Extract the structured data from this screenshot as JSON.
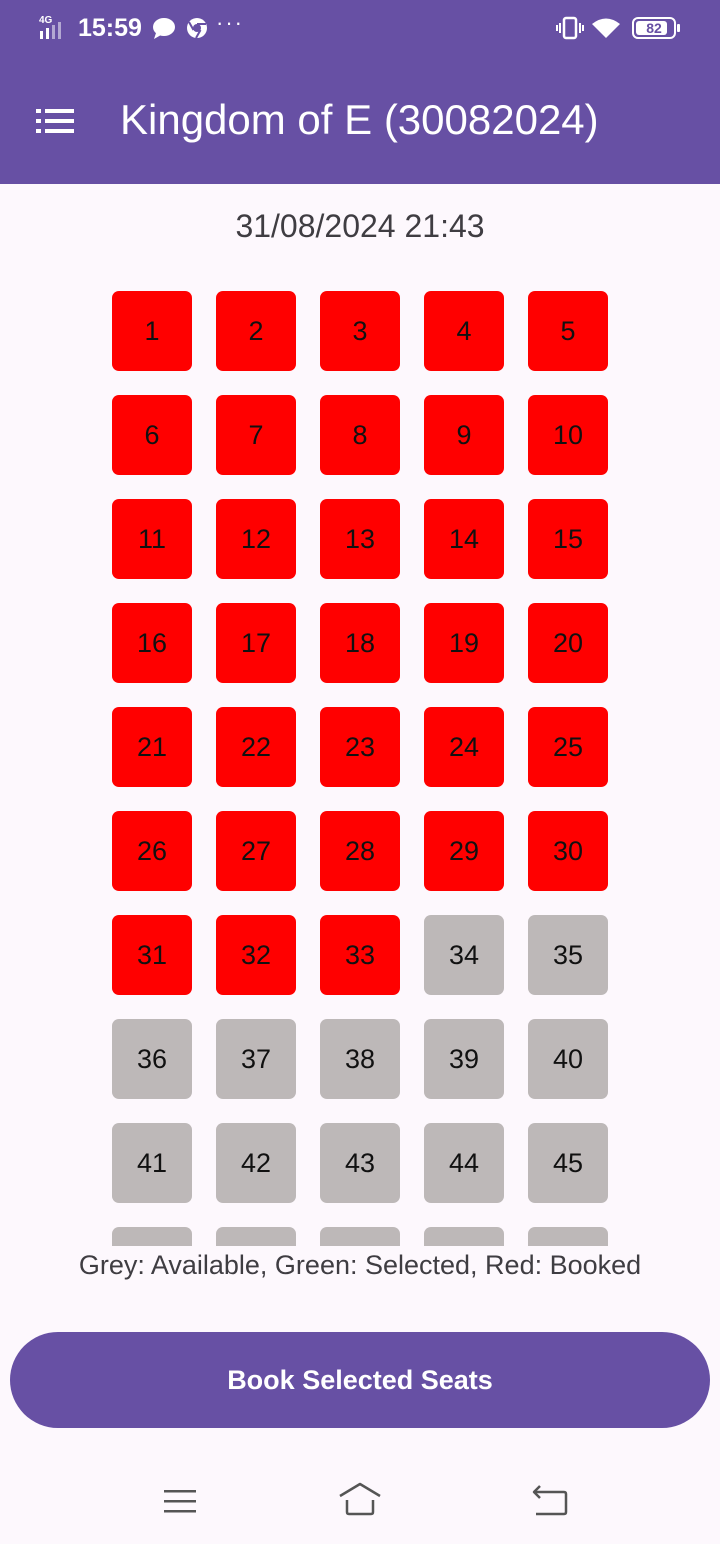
{
  "status_bar": {
    "network": "4G",
    "time": "15:59",
    "battery": "82",
    "icons": [
      "signal-icon",
      "chat-bubble-icon",
      "chrome-icon",
      "more-dots-icon",
      "vibrate-icon",
      "wifi-icon",
      "battery-icon"
    ]
  },
  "app_bar": {
    "title": "Kingdom of E (30082024)",
    "menu_icon": "list-menu-icon"
  },
  "datetime": "31/08/2024 21:43",
  "seats": [
    {
      "number": "1",
      "status": "booked"
    },
    {
      "number": "2",
      "status": "booked"
    },
    {
      "number": "3",
      "status": "booked"
    },
    {
      "number": "4",
      "status": "booked"
    },
    {
      "number": "5",
      "status": "booked"
    },
    {
      "number": "6",
      "status": "booked"
    },
    {
      "number": "7",
      "status": "booked"
    },
    {
      "number": "8",
      "status": "booked"
    },
    {
      "number": "9",
      "status": "booked"
    },
    {
      "number": "10",
      "status": "booked"
    },
    {
      "number": "11",
      "status": "booked"
    },
    {
      "number": "12",
      "status": "booked"
    },
    {
      "number": "13",
      "status": "booked"
    },
    {
      "number": "14",
      "status": "booked"
    },
    {
      "number": "15",
      "status": "booked"
    },
    {
      "number": "16",
      "status": "booked"
    },
    {
      "number": "17",
      "status": "booked"
    },
    {
      "number": "18",
      "status": "booked"
    },
    {
      "number": "19",
      "status": "booked"
    },
    {
      "number": "20",
      "status": "booked"
    },
    {
      "number": "21",
      "status": "booked"
    },
    {
      "number": "22",
      "status": "booked"
    },
    {
      "number": "23",
      "status": "booked"
    },
    {
      "number": "24",
      "status": "booked"
    },
    {
      "number": "25",
      "status": "booked"
    },
    {
      "number": "26",
      "status": "booked"
    },
    {
      "number": "27",
      "status": "booked"
    },
    {
      "number": "28",
      "status": "booked"
    },
    {
      "number": "29",
      "status": "booked"
    },
    {
      "number": "30",
      "status": "booked"
    },
    {
      "number": "31",
      "status": "booked"
    },
    {
      "number": "32",
      "status": "booked"
    },
    {
      "number": "33",
      "status": "booked"
    },
    {
      "number": "34",
      "status": "available"
    },
    {
      "number": "35",
      "status": "available"
    },
    {
      "number": "36",
      "status": "available"
    },
    {
      "number": "37",
      "status": "available"
    },
    {
      "number": "38",
      "status": "available"
    },
    {
      "number": "39",
      "status": "available"
    },
    {
      "number": "40",
      "status": "available"
    },
    {
      "number": "41",
      "status": "available"
    },
    {
      "number": "42",
      "status": "available"
    },
    {
      "number": "43",
      "status": "available"
    },
    {
      "number": "44",
      "status": "available"
    },
    {
      "number": "45",
      "status": "available"
    },
    {
      "number": "",
      "status": "available"
    },
    {
      "number": "",
      "status": "available"
    },
    {
      "number": "",
      "status": "available"
    },
    {
      "number": "",
      "status": "available"
    },
    {
      "number": "",
      "status": "available"
    }
  ],
  "legend": "Grey: Available, Green: Selected, Red: Booked",
  "book_button": "Book Selected Seats",
  "colors": {
    "primary": "#6750a4",
    "booked": "#ff0000",
    "available": "#bdb8b8",
    "selected": "#00c853",
    "background": "#fdf8fd"
  },
  "nav_bar": {
    "icons": [
      "recents-menu-icon",
      "home-icon",
      "back-icon"
    ]
  }
}
